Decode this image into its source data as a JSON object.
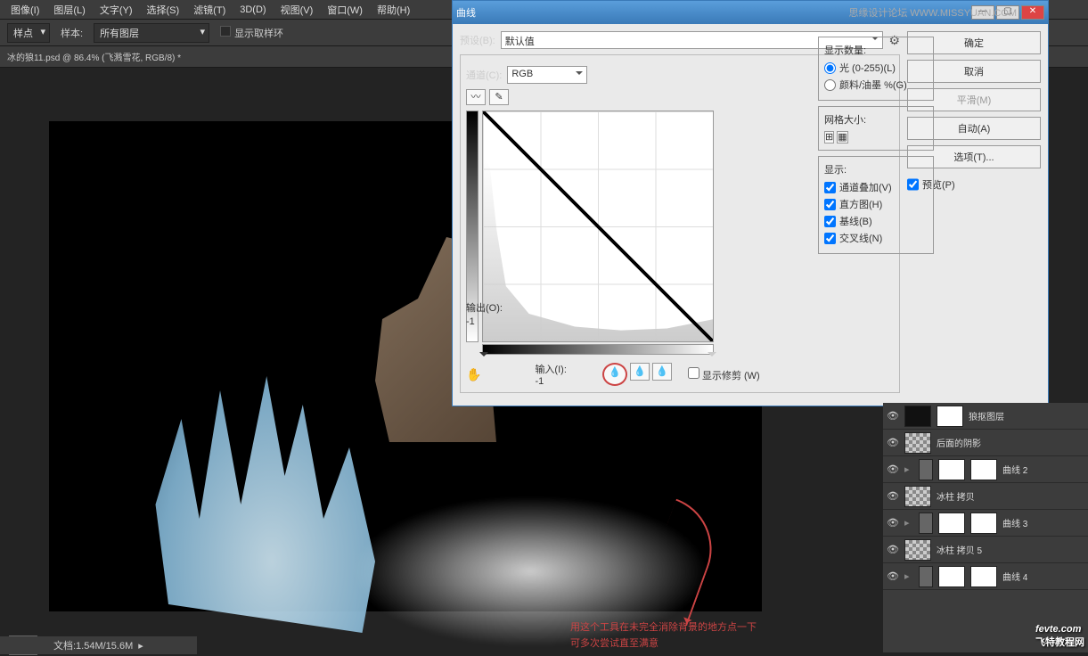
{
  "menu": {
    "image": "图像(I)",
    "layer": "图层(L)",
    "text": "文字(Y)",
    "select": "选择(S)",
    "filter": "滤镜(T)",
    "threed": "3D(D)",
    "view": "视图(V)",
    "window": "窗口(W)",
    "help": "帮助(H)"
  },
  "optbar": {
    "sample_point": "样点",
    "sample_label": "样本:",
    "sample_value": "所有图层",
    "ring": "显示取样环"
  },
  "tab": {
    "title": "冰的狼11.psd @ 86.4% (飞溅雪花, RGB/8) *"
  },
  "dialog": {
    "title": "曲线",
    "brand": "思缘设计论坛",
    "brand_url": "WWW.MISSYUAN.COM",
    "preset_label": "预设(B):",
    "preset_value": "默认值",
    "channel_label": "通道(C):",
    "channel_value": "RGB",
    "output_label": "输出(O):",
    "output_value": "-1",
    "input_label": "输入(I):",
    "input_value": "-1",
    "show_clip": "显示修剪 (W)",
    "display_amt": "显示数量:",
    "light": "光 (0-255)(L)",
    "pigment": "颜料/油墨 %(G)",
    "grid": "网格大小:",
    "show": "显示:",
    "ch_overlay": "通道叠加(V)",
    "histogram": "直方图(H)",
    "baseline": "基线(B)",
    "intersect": "交叉线(N)",
    "ok": "确定",
    "cancel": "取消",
    "smooth": "平滑(M)",
    "auto": "自动(A)",
    "options": "选项(T)...",
    "preview": "预览(P)"
  },
  "anno": {
    "l1": "用这个工具在未完全消除背景的地方点一下",
    "l2": "可多次尝试直至满意"
  },
  "status": {
    "doc": "文档:1.54M/15.6M"
  },
  "layers": [
    {
      "name": "狼抠图层",
      "thumb": "dark",
      "mask": true,
      "group": false
    },
    {
      "name": "后面的阴影",
      "thumb": "checker",
      "mask": false,
      "group": false
    },
    {
      "name": "曲线 2",
      "thumb": "mask",
      "mask": true,
      "group": true
    },
    {
      "name": "冰柱 拷贝",
      "thumb": "checker",
      "mask": false,
      "group": false
    },
    {
      "name": "曲线 3",
      "thumb": "mask",
      "mask": true,
      "group": true
    },
    {
      "name": "冰柱 拷贝 5",
      "thumb": "checker",
      "mask": false,
      "group": false
    },
    {
      "name": "曲线 4",
      "thumb": "mask",
      "mask": true,
      "group": true
    }
  ],
  "watermark": {
    "main": "fevte.com",
    "sub": "飞特教程网"
  }
}
